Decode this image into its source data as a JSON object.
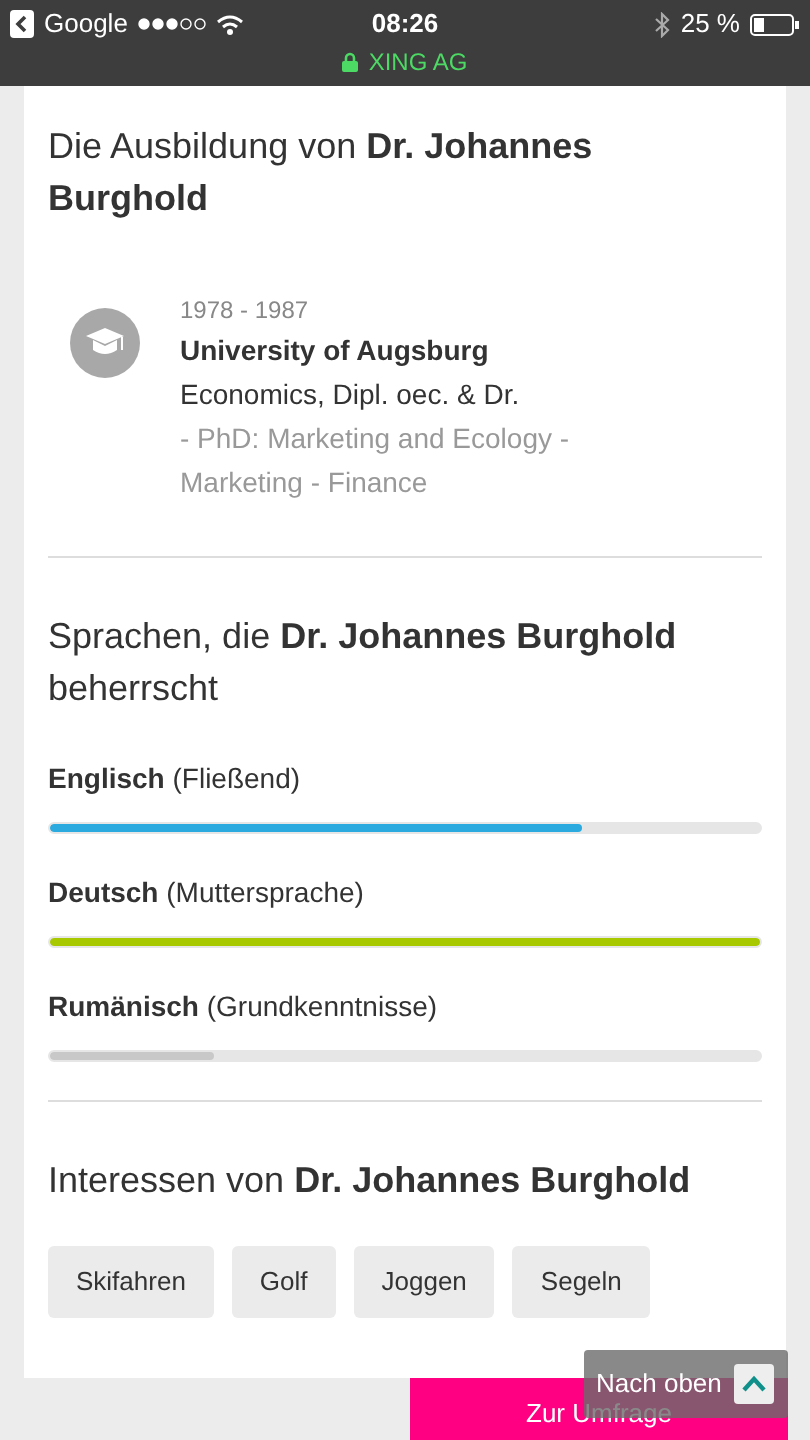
{
  "status_bar": {
    "back_app": "Google",
    "time": "08:26",
    "battery": "25 %",
    "site": "XING AG"
  },
  "education": {
    "title": "Die Ausbildung von **Dr. Johannes Burghold**",
    "entries": [
      {
        "years": "1978 - 1987",
        "school": "University of Augsburg",
        "degree": "Economics, Dipl. oec. & Dr.",
        "details": "- PhD: Marketing and Ecology - Marketing - Finance"
      }
    ]
  },
  "languages": {
    "title": "Sprachen, die **Dr. Johannes Burghold** beherrscht",
    "items": [
      {
        "name": "Englisch",
        "level_text": "(Fließend)",
        "level": 0.75,
        "color": "#2aaadf"
      },
      {
        "name": "Deutsch",
        "level_text": "(Muttersprache)",
        "level": 1,
        "color": "#a8c800"
      },
      {
        "name": "Rumänisch",
        "level_text": "(Grundkenntnisse)",
        "level": 0.23,
        "color": "#c8c8c8"
      }
    ]
  },
  "interests": {
    "title": "Interessen von **Dr. Johannes Burghold**",
    "tags": [
      "Skifahren",
      "Golf",
      "Joggen",
      "Segeln"
    ]
  },
  "survey_button": "Zur Umfrage",
  "back_to_top": "Nach oben"
}
